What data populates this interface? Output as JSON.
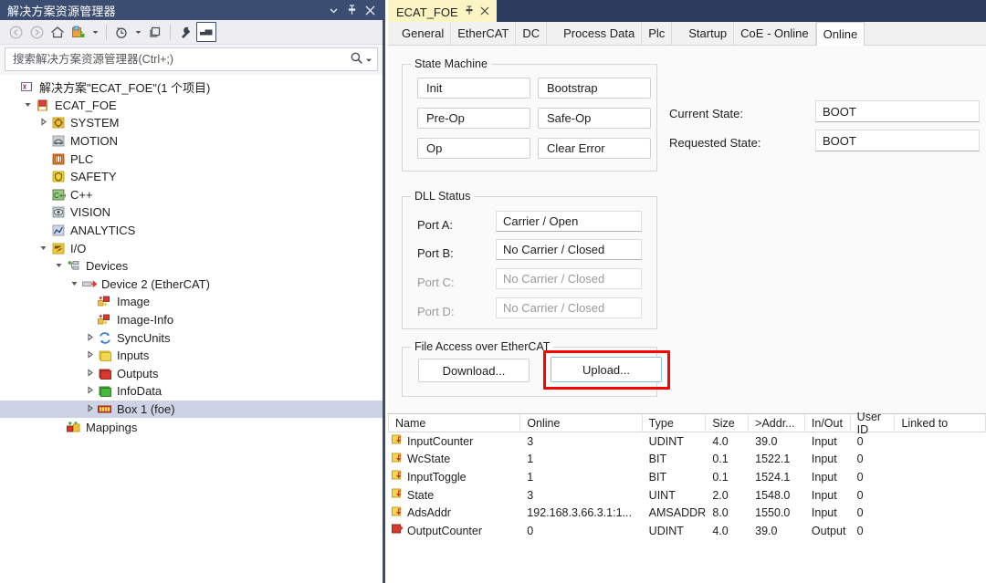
{
  "solution_explorer": {
    "title": "解决方案资源管理器",
    "titlebar_buttons": [
      {
        "name": "dropdown-icon",
        "glyph": "▾"
      },
      {
        "name": "pin-icon",
        "glyph": "⇟"
      },
      {
        "name": "close-icon",
        "glyph": "✕"
      }
    ],
    "toolbar": [
      {
        "name": "back-icon",
        "glyph": "◀"
      },
      {
        "name": "forward-icon",
        "glyph": "▶"
      },
      {
        "name": "home-icon",
        "glyph": "⌂"
      },
      {
        "name": "sync-with-active-document-icon",
        "glyph": "▣"
      },
      {
        "name": "sync-dropdown-icon",
        "glyph": "▾"
      },
      {
        "name": "refresh-icon",
        "glyph": "◷"
      },
      {
        "name": "refresh-dropdown-icon",
        "glyph": "▾"
      },
      {
        "name": "collapse-all-icon",
        "glyph": "❐"
      },
      {
        "name": "properties-icon",
        "glyph": "🔧"
      },
      {
        "name": "preview-selected-items-icon",
        "glyph": "▬"
      }
    ],
    "search": {
      "placeholder": "搜索解决方案资源管理器(Ctrl+;)",
      "value": "",
      "search_icon": "search-icon",
      "dropdown_icon": "chevron-down-icon"
    },
    "tree": [
      {
        "label": "解决方案\"ECAT_FOE\"(1 个项目)",
        "indent": 0,
        "twist": "",
        "icon": "solution-icon",
        "selected": false
      },
      {
        "label": "ECAT_FOE",
        "indent": 1,
        "twist": "▲",
        "icon": "project-icon",
        "selected": false
      },
      {
        "label": "SYSTEM",
        "indent": 2,
        "twist": "▶",
        "icon": "system-icon",
        "selected": false
      },
      {
        "label": "MOTION",
        "indent": 2,
        "twist": "",
        "icon": "motion-icon",
        "selected": false
      },
      {
        "label": "PLC",
        "indent": 2,
        "twist": "",
        "icon": "plc-icon",
        "selected": false
      },
      {
        "label": "SAFETY",
        "indent": 2,
        "twist": "",
        "icon": "safety-icon",
        "selected": false
      },
      {
        "label": "C++",
        "indent": 2,
        "twist": "",
        "icon": "cpp-icon",
        "selected": false
      },
      {
        "label": "VISION",
        "indent": 2,
        "twist": "",
        "icon": "vision-icon",
        "selected": false
      },
      {
        "label": "ANALYTICS",
        "indent": 2,
        "twist": "",
        "icon": "analytics-icon",
        "selected": false
      },
      {
        "label": "I/O",
        "indent": 2,
        "twist": "▲",
        "icon": "io-icon",
        "selected": false
      },
      {
        "label": "Devices",
        "indent": 3,
        "twist": "▲",
        "icon": "devices-icon",
        "selected": false
      },
      {
        "label": "Device 2 (EtherCAT)",
        "indent": 4,
        "twist": "▲",
        "icon": "device-ethercat-icon",
        "selected": false
      },
      {
        "label": "Image",
        "indent": 5,
        "twist": "",
        "icon": "image-icon",
        "selected": false
      },
      {
        "label": "Image-Info",
        "indent": 5,
        "twist": "",
        "icon": "image-info-icon",
        "selected": false
      },
      {
        "label": "SyncUnits",
        "indent": 5,
        "twist": "▶",
        "icon": "syncunits-icon",
        "selected": false
      },
      {
        "label": "Inputs",
        "indent": 5,
        "twist": "▶",
        "icon": "inputs-folder-icon",
        "selected": false
      },
      {
        "label": "Outputs",
        "indent": 5,
        "twist": "▶",
        "icon": "outputs-folder-icon",
        "selected": false
      },
      {
        "label": "InfoData",
        "indent": 5,
        "twist": "▶",
        "icon": "infodata-folder-icon",
        "selected": false
      },
      {
        "label": "Box 1 (foe)",
        "indent": 5,
        "twist": "▶",
        "icon": "box-icon",
        "selected": true
      },
      {
        "label": "Mappings",
        "indent": 3,
        "twist": "",
        "icon": "mappings-icon",
        "selected": false
      }
    ]
  },
  "editor": {
    "document_tab": {
      "label": "ECAT_FOE",
      "pin_icon": "pin-icon",
      "close_icon": "close-icon"
    },
    "property_tabs": [
      {
        "label": "General",
        "active": false,
        "spaced": false
      },
      {
        "label": "EtherCAT",
        "active": false,
        "spaced": false
      },
      {
        "label": "DC",
        "active": false,
        "spaced": false
      },
      {
        "label": "Process Data",
        "active": false,
        "spaced": true
      },
      {
        "label": "Plc",
        "active": false,
        "spaced": false
      },
      {
        "label": "Startup",
        "active": false,
        "spaced": true
      },
      {
        "label": "CoE - Online",
        "active": false,
        "spaced": false
      },
      {
        "label": "Online",
        "active": true,
        "spaced": false
      }
    ],
    "state_machine": {
      "legend": "State Machine",
      "buttons": [
        {
          "label": "Init"
        },
        {
          "label": "Bootstrap"
        },
        {
          "label": "Pre-Op"
        },
        {
          "label": "Safe-Op"
        },
        {
          "label": "Op"
        },
        {
          "label": "Clear Error"
        }
      ],
      "current_state_label": "Current State:",
      "current_state_value": "BOOT",
      "requested_state_label": "Requested State:",
      "requested_state_value": "BOOT"
    },
    "dll_status": {
      "legend": "DLL Status",
      "ports": [
        {
          "label": "Port A:",
          "value": "Carrier / Open",
          "disabled": false
        },
        {
          "label": "Port B:",
          "value": "No Carrier / Closed",
          "disabled": false
        },
        {
          "label": "Port C:",
          "value": "No Carrier / Closed",
          "disabled": true
        },
        {
          "label": "Port D:",
          "value": "No Carrier / Closed",
          "disabled": true
        }
      ]
    },
    "file_access": {
      "legend": "File Access over EtherCAT",
      "download_label": "Download...",
      "upload_label": "Upload...",
      "highlight_color": "#ff0000",
      "focus_border_color": "#8bbde0"
    },
    "variables_table": {
      "columns": [
        "Name",
        "Online",
        "Type",
        "Size",
        ">Addr...",
        "In/Out",
        "User ID",
        "Linked to"
      ],
      "rows": [
        {
          "icon": "input-variable-icon",
          "name": "InputCounter",
          "online": "3",
          "type": "UDINT",
          "size": "4.0",
          "addr": "39.0",
          "inout": "Input",
          "user_id": "0",
          "linked_to": ""
        },
        {
          "icon": "input-variable-icon",
          "name": "WcState",
          "online": "1",
          "type": "BIT",
          "size": "0.1",
          "addr": "1522.1",
          "inout": "Input",
          "user_id": "0",
          "linked_to": ""
        },
        {
          "icon": "input-variable-icon",
          "name": "InputToggle",
          "online": "1",
          "type": "BIT",
          "size": "0.1",
          "addr": "1524.1",
          "inout": "Input",
          "user_id": "0",
          "linked_to": ""
        },
        {
          "icon": "input-variable-icon",
          "name": "State",
          "online": "3",
          "type": "UINT",
          "size": "2.0",
          "addr": "1548.0",
          "inout": "Input",
          "user_id": "0",
          "linked_to": ""
        },
        {
          "icon": "input-variable-icon",
          "name": "AdsAddr",
          "online": "192.168.3.66.3.1:1...",
          "type": "AMSADDR",
          "size": "8.0",
          "addr": "1550.0",
          "inout": "Input",
          "user_id": "0",
          "linked_to": ""
        },
        {
          "icon": "output-variable-icon",
          "name": "OutputCounter",
          "online": "0",
          "type": "UDINT",
          "size": "4.0",
          "addr": "39.0",
          "inout": "Output",
          "user_id": "0",
          "linked_to": ""
        }
      ]
    }
  }
}
